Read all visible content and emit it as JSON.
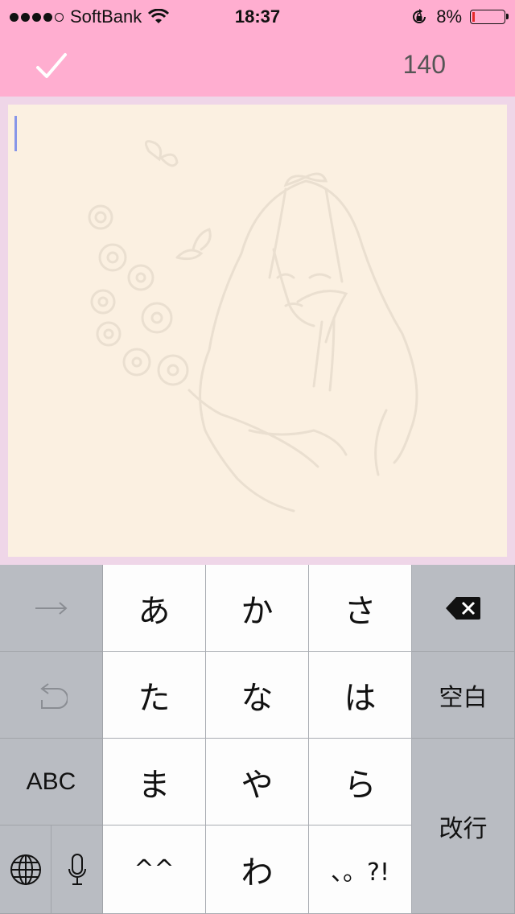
{
  "status_bar": {
    "carrier": "SoftBank",
    "time": "18:37",
    "battery_percent": "8%",
    "battery_level": 0.08,
    "signal_bars": 4,
    "icons": [
      "signal-dots-icon",
      "wifi-icon",
      "rotation-lock-icon",
      "battery-icon"
    ]
  },
  "toolbar": {
    "done_icon": "checkmark-icon",
    "char_count": "140"
  },
  "editor": {
    "text": "",
    "background_color": "#fbf0e1",
    "illustration": "girl-with-flowers-and-butterflies"
  },
  "keyboard": {
    "left_column": {
      "next_icon": "arrow-right-icon",
      "undo_icon": "undo-icon",
      "abc_label": "ABC",
      "globe_icon": "globe-icon",
      "mic_icon": "microphone-icon"
    },
    "kana_keys": [
      "あ",
      "か",
      "さ",
      "た",
      "な",
      "は",
      "ま",
      "や",
      "ら",
      "^^",
      "わ",
      "、。?!"
    ],
    "right_column": {
      "delete_icon": "backspace-icon",
      "space_label": "空白",
      "return_label": "改行"
    }
  },
  "colors": {
    "header": "#ffaed0",
    "page_background": "#efd6e8",
    "cursor": "#8796e8"
  }
}
